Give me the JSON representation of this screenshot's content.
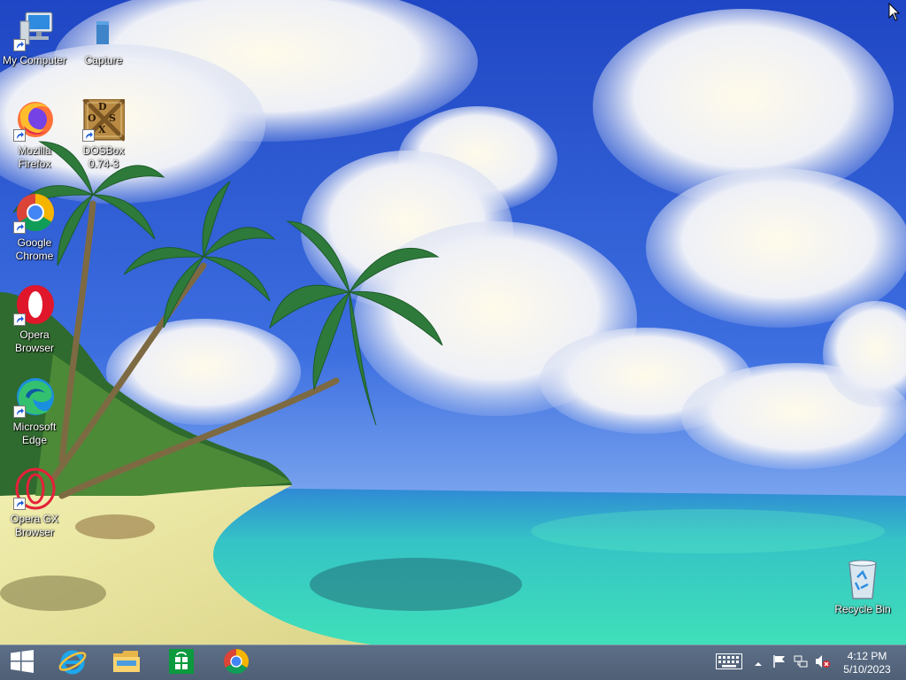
{
  "desktop": {
    "icons": [
      {
        "label": "My Computer",
        "icon": "computer-icon"
      },
      {
        "label": "Capture",
        "icon": "file-icon"
      },
      {
        "label": "Mozilla\nFirefox",
        "icon": "firefox-icon"
      },
      {
        "label": "DOSBox\n0.74-3",
        "icon": "dosbox-icon"
      },
      {
        "label": "Google\nChrome",
        "icon": "chrome-icon"
      },
      {
        "label": "Opera\nBrowser",
        "icon": "opera-icon"
      },
      {
        "label": "Microsoft\nEdge",
        "icon": "edge-icon"
      },
      {
        "label": "Opera GX\nBrowser",
        "icon": "opera-gx-icon"
      },
      {
        "label": "Recycle Bin",
        "icon": "recycle-bin-icon"
      }
    ],
    "dosbox_logo_text": "DOSX"
  },
  "taskbar": {
    "pinned": [
      "start-icon",
      "internet-explorer-icon",
      "file-explorer-icon",
      "store-icon",
      "chrome-icon"
    ],
    "tray": [
      "keyboard-icon",
      "chevron-up-icon",
      "flag-icon",
      "network-icon",
      "volume-muted-icon"
    ],
    "clock": {
      "time": "4:12 PM",
      "date": "5/10/2023"
    }
  },
  "colors": {
    "sky": "#2b57c8",
    "taskbar": "#56677e",
    "text": "#ffffff"
  }
}
